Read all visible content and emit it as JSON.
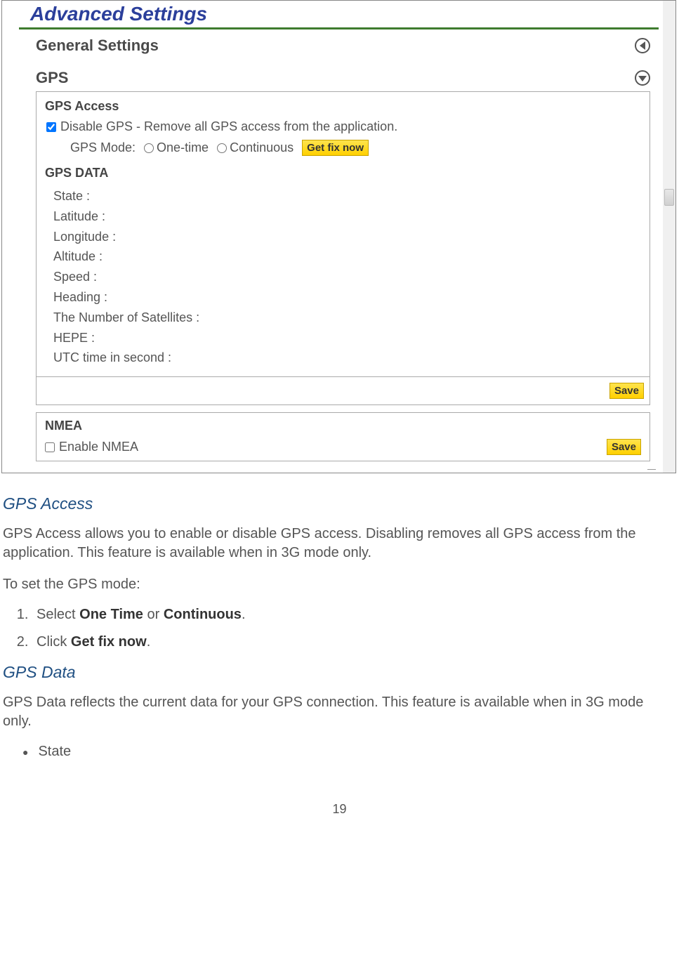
{
  "screenshot": {
    "title": "Advanced Settings",
    "section_general": "General Settings",
    "section_gps": "GPS",
    "gps_access_heading": "GPS Access",
    "disable_label": "Disable GPS - Remove all GPS access from the application.",
    "gps_mode_label": "GPS Mode:",
    "mode_onetime": "One-time",
    "mode_continuous": "Continuous",
    "get_fix_btn": "Get fix now",
    "gps_data_heading": "GPS DATA",
    "data_fields": {
      "state": "State :",
      "latitude": "Latitude :",
      "longitude": "Longitude :",
      "altitude": "Altitude :",
      "speed": "Speed :",
      "heading": "Heading :",
      "satellites": "The Number of Satellites :",
      "hepe": "HEPE :",
      "utc": "UTC time in second :"
    },
    "save_btn": "Save",
    "nmea_heading": "NMEA",
    "nmea_enable": "Enable NMEA",
    "nmea_save": "Save"
  },
  "doc": {
    "h_gps_access": "GPS Access",
    "p_gps_access": "GPS Access allows you to enable or disable GPS access.  Disabling removes all GPS access from the application. This feature is available when in 3G mode only.",
    "p_to_set": "To set the GPS mode:",
    "step1_pre": "Select ",
    "step1_b1": "One Time",
    "step1_mid": " or ",
    "step1_b2": "Continuous",
    "step1_suf": ".",
    "step2_pre": "Click ",
    "step2_b": "Get fix now",
    "step2_suf": ".",
    "h_gps_data": "GPS Data",
    "p_gps_data": "GPS Data reflects the current data for your GPS connection. This feature is available when in 3G mode only.",
    "bullet_state": "State",
    "page_number": "19"
  }
}
